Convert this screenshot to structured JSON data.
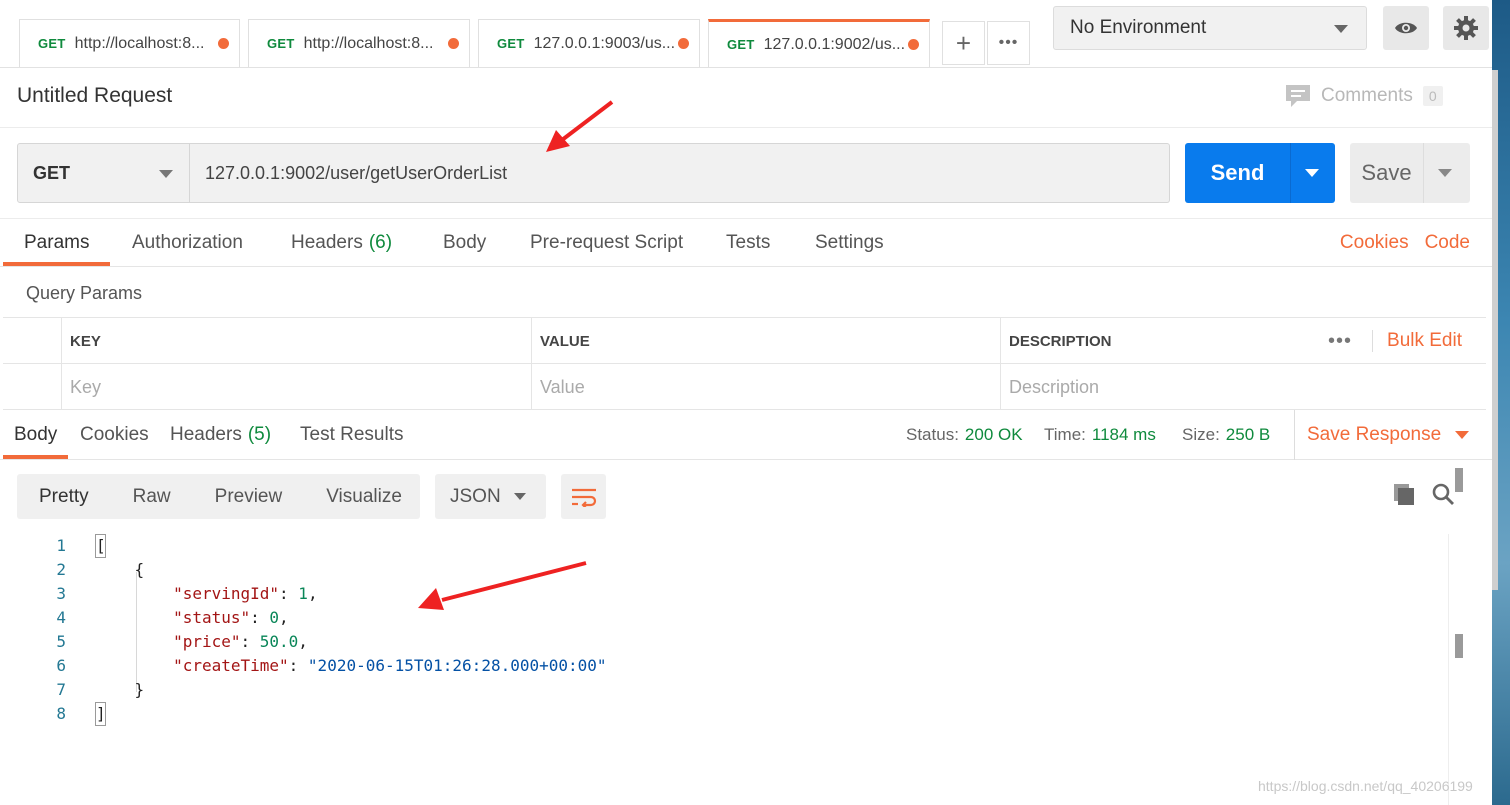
{
  "tabs": [
    {
      "method": "GET",
      "url": "http://localhost:8...",
      "unsaved": true
    },
    {
      "method": "GET",
      "url": "http://localhost:8...",
      "unsaved": true
    },
    {
      "method": "GET",
      "url": "127.0.0.1:9003/us...",
      "unsaved": true
    },
    {
      "method": "GET",
      "url": "127.0.0.1:9002/us...",
      "unsaved": true,
      "active": true
    }
  ],
  "tab_actions": {
    "new_tab": "+",
    "more": "•••"
  },
  "environment": {
    "selected": "No Environment"
  },
  "request": {
    "title": "Untitled Request",
    "comments_label": "Comments",
    "comments_count": "0",
    "method": "GET",
    "url": "127.0.0.1:9002/user/getUserOrderList",
    "send_label": "Send",
    "save_label": "Save"
  },
  "request_tabs": [
    {
      "label": "Params",
      "count": ""
    },
    {
      "label": "Authorization",
      "count": ""
    },
    {
      "label": "Headers",
      "count": "(6)"
    },
    {
      "label": "Body",
      "count": ""
    },
    {
      "label": "Pre-request Script",
      "count": ""
    },
    {
      "label": "Tests",
      "count": ""
    },
    {
      "label": "Settings",
      "count": ""
    }
  ],
  "request_links": {
    "cookies": "Cookies",
    "code": "Code"
  },
  "query_params": {
    "title": "Query Params",
    "headers": [
      "KEY",
      "VALUE",
      "DESCRIPTION"
    ],
    "placeholders": [
      "Key",
      "Value",
      "Description"
    ],
    "more": "•••",
    "bulk_edit": "Bulk Edit"
  },
  "response_tabs": [
    {
      "label": "Body",
      "count": ""
    },
    {
      "label": "Cookies",
      "count": ""
    },
    {
      "label": "Headers",
      "count": "(5)"
    },
    {
      "label": "Test Results",
      "count": ""
    }
  ],
  "response_meta": {
    "status_label": "Status:",
    "status_value": "200 OK",
    "time_label": "Time:",
    "time_value": "1184 ms",
    "size_label": "Size:",
    "size_value": "250 B",
    "save_response": "Save Response"
  },
  "body_view": {
    "modes": [
      "Pretty",
      "Raw",
      "Preview",
      "Visualize"
    ],
    "format": "JSON"
  },
  "response_body": {
    "line_numbers": [
      "1",
      "2",
      "3",
      "4",
      "5",
      "6",
      "7",
      "8"
    ],
    "keys": {
      "servingId": "\"servingId\"",
      "status": "\"status\"",
      "price": "\"price\"",
      "createTime": "\"createTime\""
    },
    "values": {
      "servingId": "1",
      "status": "0",
      "price": "50.0",
      "createTime": "\"2020-06-15T01:26:28.000+00:00\""
    }
  },
  "watermark": "https://blog.csdn.net/qq_40206199",
  "colors": {
    "accent": "#f26b3a",
    "send": "#097bed",
    "success": "#0f8a3d"
  }
}
